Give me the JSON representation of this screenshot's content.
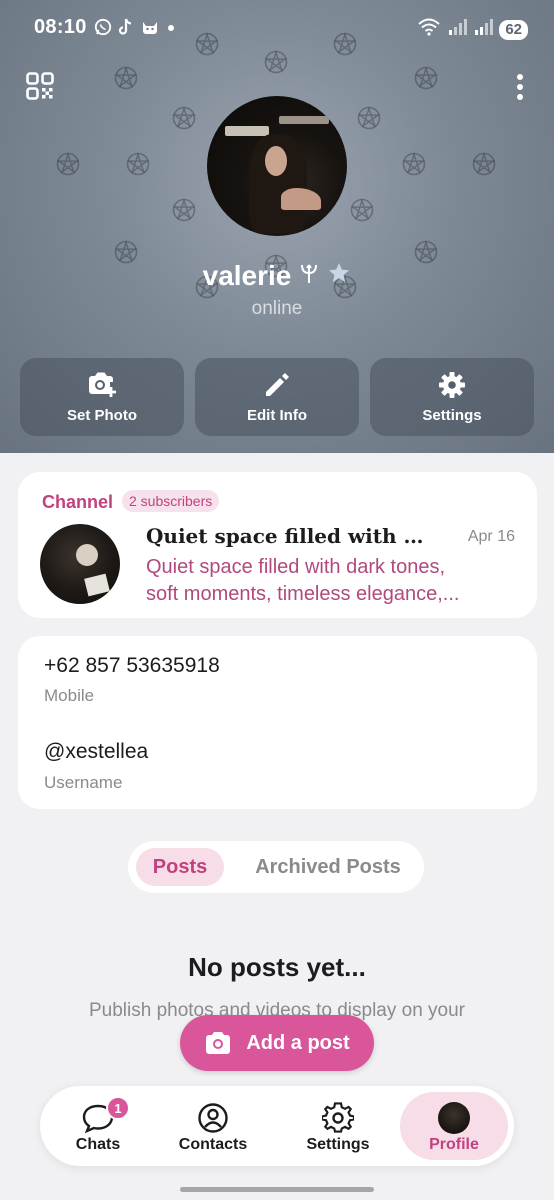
{
  "status_bar": {
    "time": "08:10",
    "battery": "62"
  },
  "profile": {
    "name": "valerie",
    "status": "online"
  },
  "actions": [
    {
      "label": "Set Photo"
    },
    {
      "label": "Edit Info"
    },
    {
      "label": "Settings"
    }
  ],
  "channel": {
    "label": "Channel",
    "subscribers": "2 subscribers",
    "title": "Quiet space filled with dar...",
    "date": "Apr 16",
    "preview_line1": "Quiet space filled with dark tones,",
    "preview_line2": "soft moments, timeless elegance,..."
  },
  "info": {
    "phone": "+62 857 53635918",
    "phone_label": "Mobile",
    "username": "@xestellea",
    "username_label": "Username"
  },
  "tabs": {
    "posts": "Posts",
    "archived": "Archived Posts"
  },
  "empty_state": {
    "title": "No posts yet...",
    "subtitle": "Publish photos and videos to display on your"
  },
  "add_post_label": "Add a post",
  "bottom_nav": {
    "items": [
      {
        "label": "Chats",
        "badge": "1"
      },
      {
        "label": "Contacts"
      },
      {
        "label": "Settings"
      },
      {
        "label": "Profile"
      }
    ]
  },
  "colors": {
    "accent": "#c2417f",
    "button_pink": "#d9569a",
    "header_bg": "#7e8996"
  },
  "icons": [
    "qr-code-icon",
    "more-vertical-icon",
    "camera-plus-icon",
    "pencil-icon",
    "gear-icon",
    "pentagram-icon",
    "camera-icon",
    "chat-bubble-icon",
    "person-circle-icon"
  ]
}
